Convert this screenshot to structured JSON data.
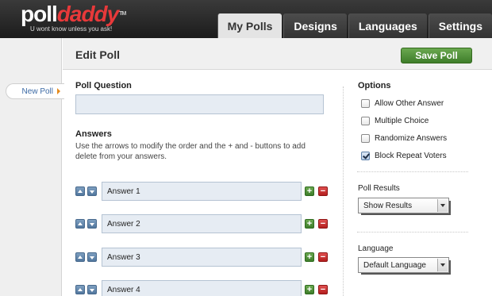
{
  "logo": {
    "part1": "poll",
    "part2": "daddy",
    "tm": "TM",
    "tagline": "U wont know unless you ask!"
  },
  "tabs": [
    {
      "label": "My Polls",
      "active": true
    },
    {
      "label": "Designs",
      "active": false
    },
    {
      "label": "Languages",
      "active": false
    },
    {
      "label": "Settings",
      "active": false
    }
  ],
  "sidebar": {
    "new_poll": "New Poll"
  },
  "page": {
    "title": "Edit Poll",
    "save_label": "Save Poll"
  },
  "question": {
    "label": "Poll Question",
    "value": ""
  },
  "answers": {
    "label": "Answers",
    "help": "Use the arrows to modify the order and the + and - buttons to add delete from your answers.",
    "items": [
      "Answer 1",
      "Answer 2",
      "Answer 3",
      "Answer 4"
    ],
    "plus": "+",
    "minus": "−"
  },
  "options": {
    "label": "Options",
    "items": [
      {
        "label": "Allow Other Answer",
        "checked": false
      },
      {
        "label": "Multiple Choice",
        "checked": false
      },
      {
        "label": "Randomize Answers",
        "checked": false
      },
      {
        "label": "Block Repeat Voters",
        "checked": true
      }
    ]
  },
  "poll_results": {
    "label": "Poll Results",
    "selected": "Show Results"
  },
  "language": {
    "label": "Language",
    "selected": "Default Language"
  },
  "colors": {
    "save_green": "#4f8f36",
    "header_dark": "#262626",
    "logo_red": "#e8393a",
    "link_blue": "#3c6aa5"
  }
}
